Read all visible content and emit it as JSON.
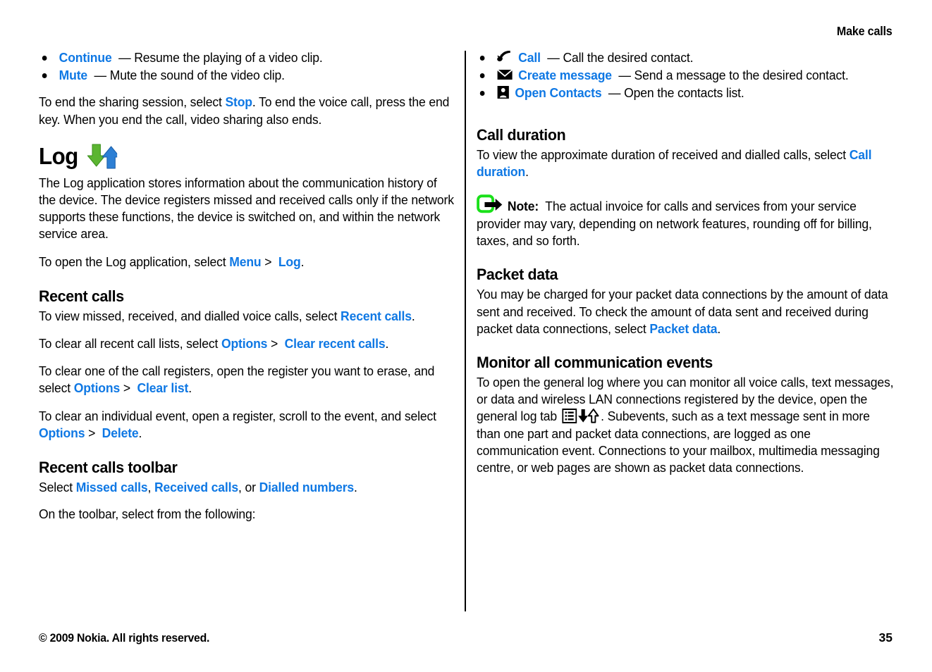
{
  "header": {
    "chapter_title": "Make calls"
  },
  "footer": {
    "copyright": "© 2009 Nokia. All rights reserved.",
    "page_number": "35"
  },
  "colors": {
    "link": "#0f78e4",
    "log_icon_down_arrow": "#5cb531",
    "log_icon_up_arrow": "#2d7fd4",
    "note_icon_frame": "#1ae01a",
    "text": "#000000",
    "background": "#ffffff"
  },
  "left_column": {
    "video_share_bullets": [
      {
        "link": "Continue",
        "dash": "—",
        "text": "Resume the playing of a video clip."
      },
      {
        "link": "Mute",
        "dash": "—",
        "text": "Mute the sound of the video clip."
      }
    ],
    "end_sharing_para": {
      "p1": "To end the sharing session, select ",
      "link1": "Stop",
      "p2": ". To end the voice call, press the end key. When you end the call, video sharing also ends."
    },
    "log_heading": "Log",
    "log_icon": "log-icon",
    "log_intro": "The Log application stores information about the communication history of the device. The device registers missed and received calls only if the network supports these functions, the device is switched on, and within the network service area.",
    "open_log_para": {
      "p1": "To open the Log application, select ",
      "link1": "Menu",
      "sep": ">",
      "link2": "Log",
      "p2": "."
    },
    "recent_calls_heading": "Recent calls",
    "recent_calls_view": {
      "p1": "To view missed, received, and dialled voice calls, select ",
      "link1": "Recent calls",
      "p2": "."
    },
    "recent_calls_clear_all": {
      "p1": "To clear all recent call lists, select ",
      "link1": "Options",
      "sep": ">",
      "link2": "Clear recent calls",
      "p2": "."
    },
    "recent_calls_clear_one": {
      "p1": "To clear one of the call registers, open the register you want to erase, and select ",
      "link1": "Options",
      "sep": ">",
      "link2": "Clear list",
      "p2": "."
    },
    "recent_calls_clear_event": {
      "p1": "To clear an individual event, open a register, scroll to the event, and select ",
      "link1": "Options",
      "sep": ">",
      "link2": "Delete",
      "p2": "."
    },
    "toolbar_heading": "Recent calls toolbar",
    "toolbar_select": {
      "p1": "Select ",
      "link1": "Missed calls",
      "p2": ", ",
      "link2": "Received calls",
      "p3": ", or ",
      "link3": "Dialled numbers",
      "p4": "."
    },
    "toolbar_intro": "On the toolbar, select from the following:"
  },
  "right_column": {
    "toolbar_bullets": [
      {
        "icon": "phone-handset-icon",
        "link": "Call",
        "dash": "—",
        "text": "Call the desired contact."
      },
      {
        "icon": "envelope-icon",
        "link": "Create message",
        "dash": "—",
        "text": "Send a message to the desired contact."
      },
      {
        "icon": "contacts-icon",
        "link": "Open Contacts",
        "dash": "—",
        "text": "Open the contacts list."
      }
    ],
    "call_duration_heading": "Call duration",
    "call_duration_para": {
      "p1": "To view the approximate duration of received and dialled calls, select ",
      "link1": "Call duration",
      "p2": "."
    },
    "note": {
      "icon": "note-arrow-icon",
      "label": "Note:",
      "text": "The actual invoice for calls and services from your service provider may vary, depending on network features, rounding off for billing, taxes, and so forth."
    },
    "packet_data_heading": "Packet data",
    "packet_data_para": {
      "p1": "You may be charged for your packet data connections by the amount of data sent and received. To check the amount of data sent and received during packet data connections, select ",
      "link1": "Packet data",
      "p2": "."
    },
    "monitor_heading": "Monitor all communication events",
    "monitor_para": {
      "p1": "To open the general log where you can monitor all voice calls, text messages, or data and wireless LAN connections registered by the device, open the general log tab ",
      "icon1": "log-list-tab-icon",
      "icon2": "down-up-arrows-icon",
      "p2": ". Subevents, such as a text message sent in more than one part and packet data connections, are logged as one communication event. Connections to your mailbox, multimedia messaging centre, or web pages are shown as packet data connections."
    }
  }
}
